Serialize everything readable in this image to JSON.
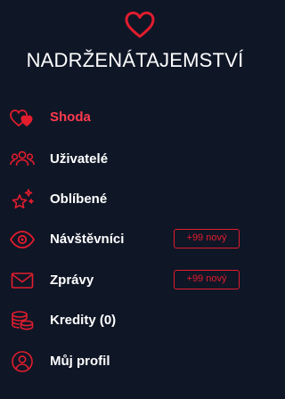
{
  "brand": {
    "name": "NADRŽENÁTAJEMSTVÍ"
  },
  "colors": {
    "accent": "#e11d2e",
    "background": "#0f1626",
    "text": "#ffffff"
  },
  "menu": {
    "items": [
      {
        "label": "Shoda",
        "icon": "hearts-icon",
        "active": true
      },
      {
        "label": "Uživatelé",
        "icon": "users-icon"
      },
      {
        "label": "Oblíbené",
        "icon": "sparkle-star-icon"
      },
      {
        "label": "Návštěvníci",
        "icon": "eye-icon",
        "badge": "+99 nový"
      },
      {
        "label": "Zprávy",
        "icon": "envelope-icon",
        "badge": "+99 nový"
      },
      {
        "label": "Kredity (0)",
        "icon": "coins-icon"
      },
      {
        "label": "Můj profil",
        "icon": "user-circle-icon"
      }
    ]
  }
}
